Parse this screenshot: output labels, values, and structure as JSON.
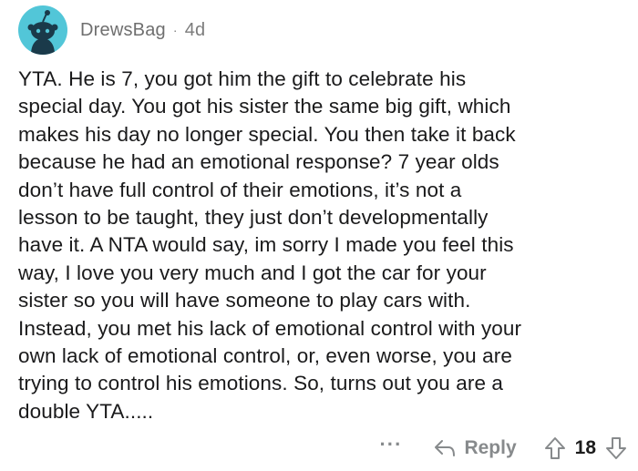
{
  "comment": {
    "username": "DrewsBag",
    "separator": "·",
    "age": "4d",
    "body_lines": [
      "YTA. He is 7, you got him the gift to celebrate his",
      "special day. You got his sister the same big gift, which",
      "makes his day no longer special. You then take it back",
      "because he had an emotional response? 7 year olds",
      "don’t have full control of their emotions, it’s not a",
      "lesson to be taught, they just don’t developmentally",
      "have it. A NTA would say, im sorry I made you feel this",
      "way, I love you very much and I got the car for your",
      "sister so you will have someone to play cars with.",
      "Instead, you met his lack of emotional control with your",
      "own lack of emotional control, or, even worse, you are",
      "trying to control his emotions. So, turns out you are a",
      "double YTA....."
    ],
    "actions": {
      "more": "···",
      "reply_label": "Reply",
      "score": "18"
    }
  },
  "colors": {
    "avatar_bg": "#52c6d8",
    "meta_text": "#7c7c7c",
    "action_text": "#878a8c"
  },
  "icons": {
    "avatar": "snoo-avatar-icon",
    "reply": "reply-arrow-icon",
    "upvote": "upvote-arrow-icon",
    "downvote": "downvote-arrow-icon"
  }
}
